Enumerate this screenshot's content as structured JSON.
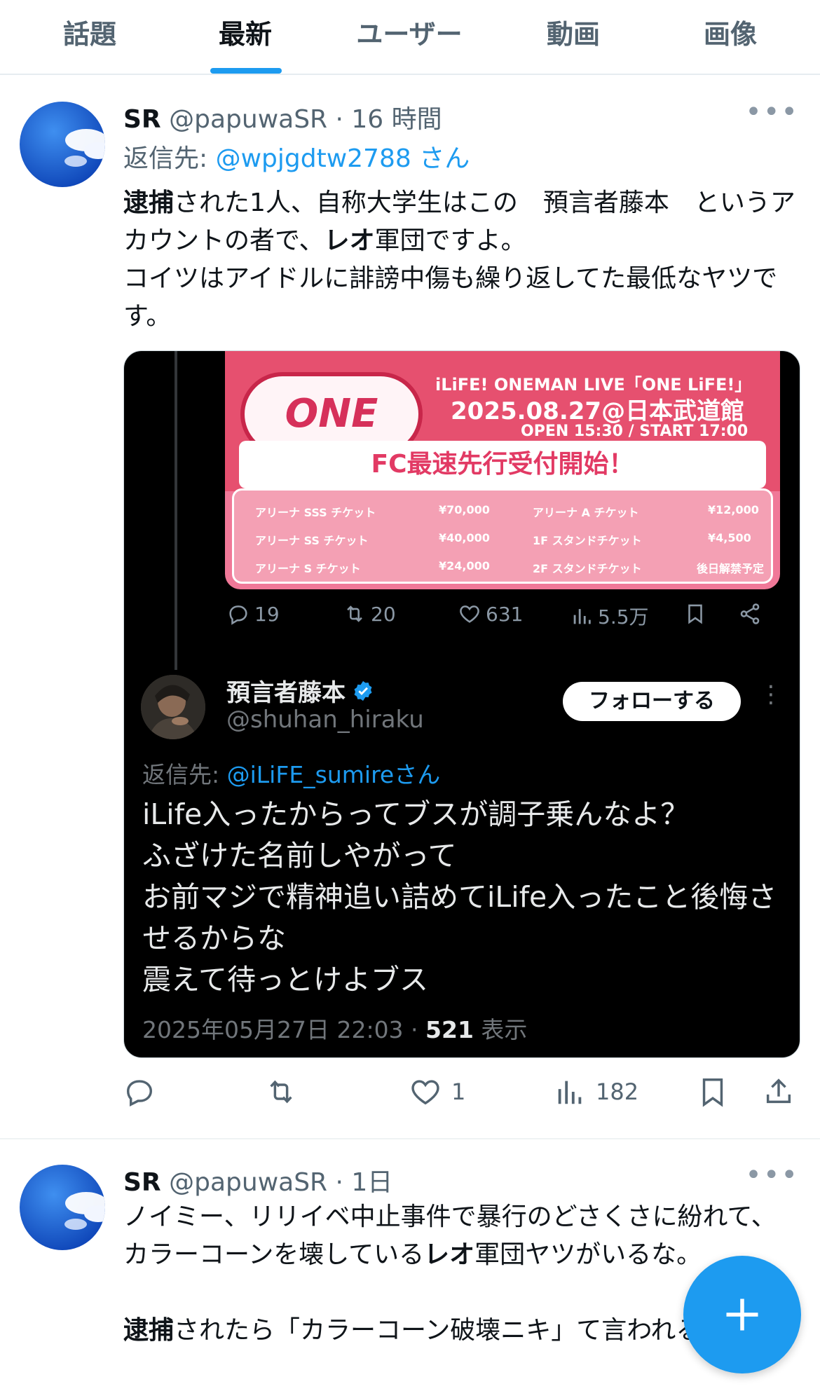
{
  "tabs": [
    {
      "label": "話題"
    },
    {
      "label": "最新"
    },
    {
      "label": "ユーザー"
    },
    {
      "label": "動画"
    },
    {
      "label": "画像"
    }
  ],
  "tweet1": {
    "name": "SR",
    "meta": "@papuwaSR · 16 時間",
    "reply_prefix": "返信先: ",
    "reply_handle": "@wpjgdtw2788 さん",
    "body_b1": "逮捕",
    "body_t1": "された1人、自称大学生はこの　預言者藤本　というアカウントの者で、",
    "body_b2": "レオ",
    "body_t2": "軍団ですよ。",
    "body_t3": "コイツはアイドルに誹謗中傷も繰り返してた最低なヤツです。",
    "embed": {
      "poster_logo": "ONE LiFE!",
      "poster_title": "iLiFE! ONEMAN LIVE「ONE LiFE!」",
      "poster_date": "2025.08.27@日本武道館",
      "poster_open": "OPEN 15:30 / START 17:00",
      "poster_banner": "FC最速先行受付開始！",
      "prices": [
        {
          "label": "アリーナ SSS チケット",
          "price": "¥70,000"
        },
        {
          "label": "アリーナ SS チケット",
          "price": "¥40,000"
        },
        {
          "label": "アリーナ S チケット",
          "price": "¥24,000"
        },
        {
          "label": "アリーナ A チケット",
          "price": "¥12,000"
        },
        {
          "label": "1F スタンドチケット",
          "price": "¥4,500"
        },
        {
          "label": "2F スタンドチケット",
          "price": "後日解禁予定"
        }
      ],
      "prev_replies": "19",
      "prev_retweets": "20",
      "prev_likes": "631",
      "prev_views": "5.5万",
      "name": "預言者藤本",
      "handle": "@shuhan_hiraku",
      "follow_label": "フォローする",
      "reply_prefix": "返信先: ",
      "reply_handle": "@iLiFE_sumireさん",
      "body_lines": [
        "iLife入ったからってブスが調子乗んなよ？",
        "ふざけた名前しやがって",
        "お前マジで精神追い詰めてiLife入ったこと後悔させるからな",
        "震えて待っとけよブス"
      ],
      "time": "2025年05月27日 22:03 · ",
      "views_count": "521",
      "views_label": " 表示"
    },
    "likes": "1",
    "views": "182"
  },
  "tweet2": {
    "name": "SR",
    "meta": "@papuwaSR · 1日",
    "body_t1": "ノイミー、リリイベ中止事件で暴行のどさくさに紛れて、カラーコーンを壊している",
    "body_b1": "レオ",
    "body_t2": "軍団ヤツがいるな。",
    "body_b2": "逮捕",
    "body_t3": "されたら「カラーコーン破壊ニキ」て言われるんだ"
  },
  "colors": {
    "accent": "#1d9bf0",
    "text": "#0f1419",
    "muted": "#536471"
  }
}
